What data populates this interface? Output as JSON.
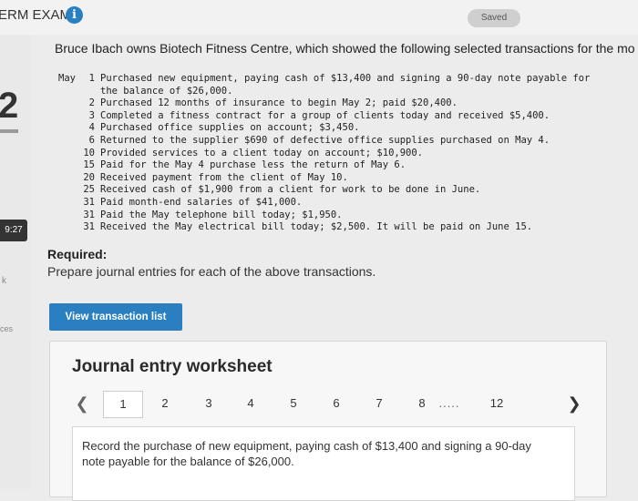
{
  "header": {
    "exam_title": "ERM EXAM",
    "info_icon": "info-icon",
    "saved_label": "Saved"
  },
  "left_rail": {
    "step_digit": "2",
    "timer": "9:27",
    "k_label": "k",
    "ces_label": "ces"
  },
  "problem": {
    "intro": "Bruce Ibach owns Biotech Fitness Centre, which showed the following selected transactions for the mo",
    "transactions": [
      {
        "month": "May",
        "day": "1",
        "text": "Purchased new equipment, paying cash of $13,400 and signing a 90-day note payable for",
        "continuation": "the balance of $26,000."
      },
      {
        "month": "",
        "day": "2",
        "text": "Purchased 12 months of insurance to begin May 2; paid $20,400."
      },
      {
        "month": "",
        "day": "3",
        "text": "Completed a fitness contract for a group of clients today and received $5,400."
      },
      {
        "month": "",
        "day": "4",
        "text": "Purchased office supplies on account; $3,450."
      },
      {
        "month": "",
        "day": "6",
        "text": "Returned to the supplier $690 of defective office supplies purchased on May 4."
      },
      {
        "month": "",
        "day": "10",
        "text": "Provided services to a client today on account; $10,900."
      },
      {
        "month": "",
        "day": "15",
        "text": "Paid for the May 4 purchase less the return of May 6."
      },
      {
        "month": "",
        "day": "20",
        "text": "Received payment from the client of May 10."
      },
      {
        "month": "",
        "day": "25",
        "text": "Received cash of $1,900 from a client for work to be done in June."
      },
      {
        "month": "",
        "day": "31",
        "text": "Paid month-end salaries of $41,000."
      },
      {
        "month": "",
        "day": "31",
        "text": "Paid the May telephone bill today; $1,950."
      },
      {
        "month": "",
        "day": "31",
        "text": "Received the May electrical bill today; $2,500. It will be paid on June 15."
      }
    ],
    "required_label": "Required:",
    "required_text": "Prepare journal entries for each of the above transactions."
  },
  "view_button": "View transaction list",
  "worksheet": {
    "title": "Journal entry worksheet",
    "prev_icon": "chevron-left-icon",
    "next_icon": "chevron-right-icon",
    "pages": [
      "1",
      "2",
      "3",
      "4",
      "5",
      "6",
      "7",
      "8"
    ],
    "ellipsis": ".....",
    "last_page": "12",
    "active_page": "1",
    "description": "Record the purchase of new equipment, paying cash of $13,400 and signing a 90-day note payable for the balance of $26,000."
  },
  "colors": {
    "accent": "#2a7fc1",
    "background": "#ececec"
  }
}
